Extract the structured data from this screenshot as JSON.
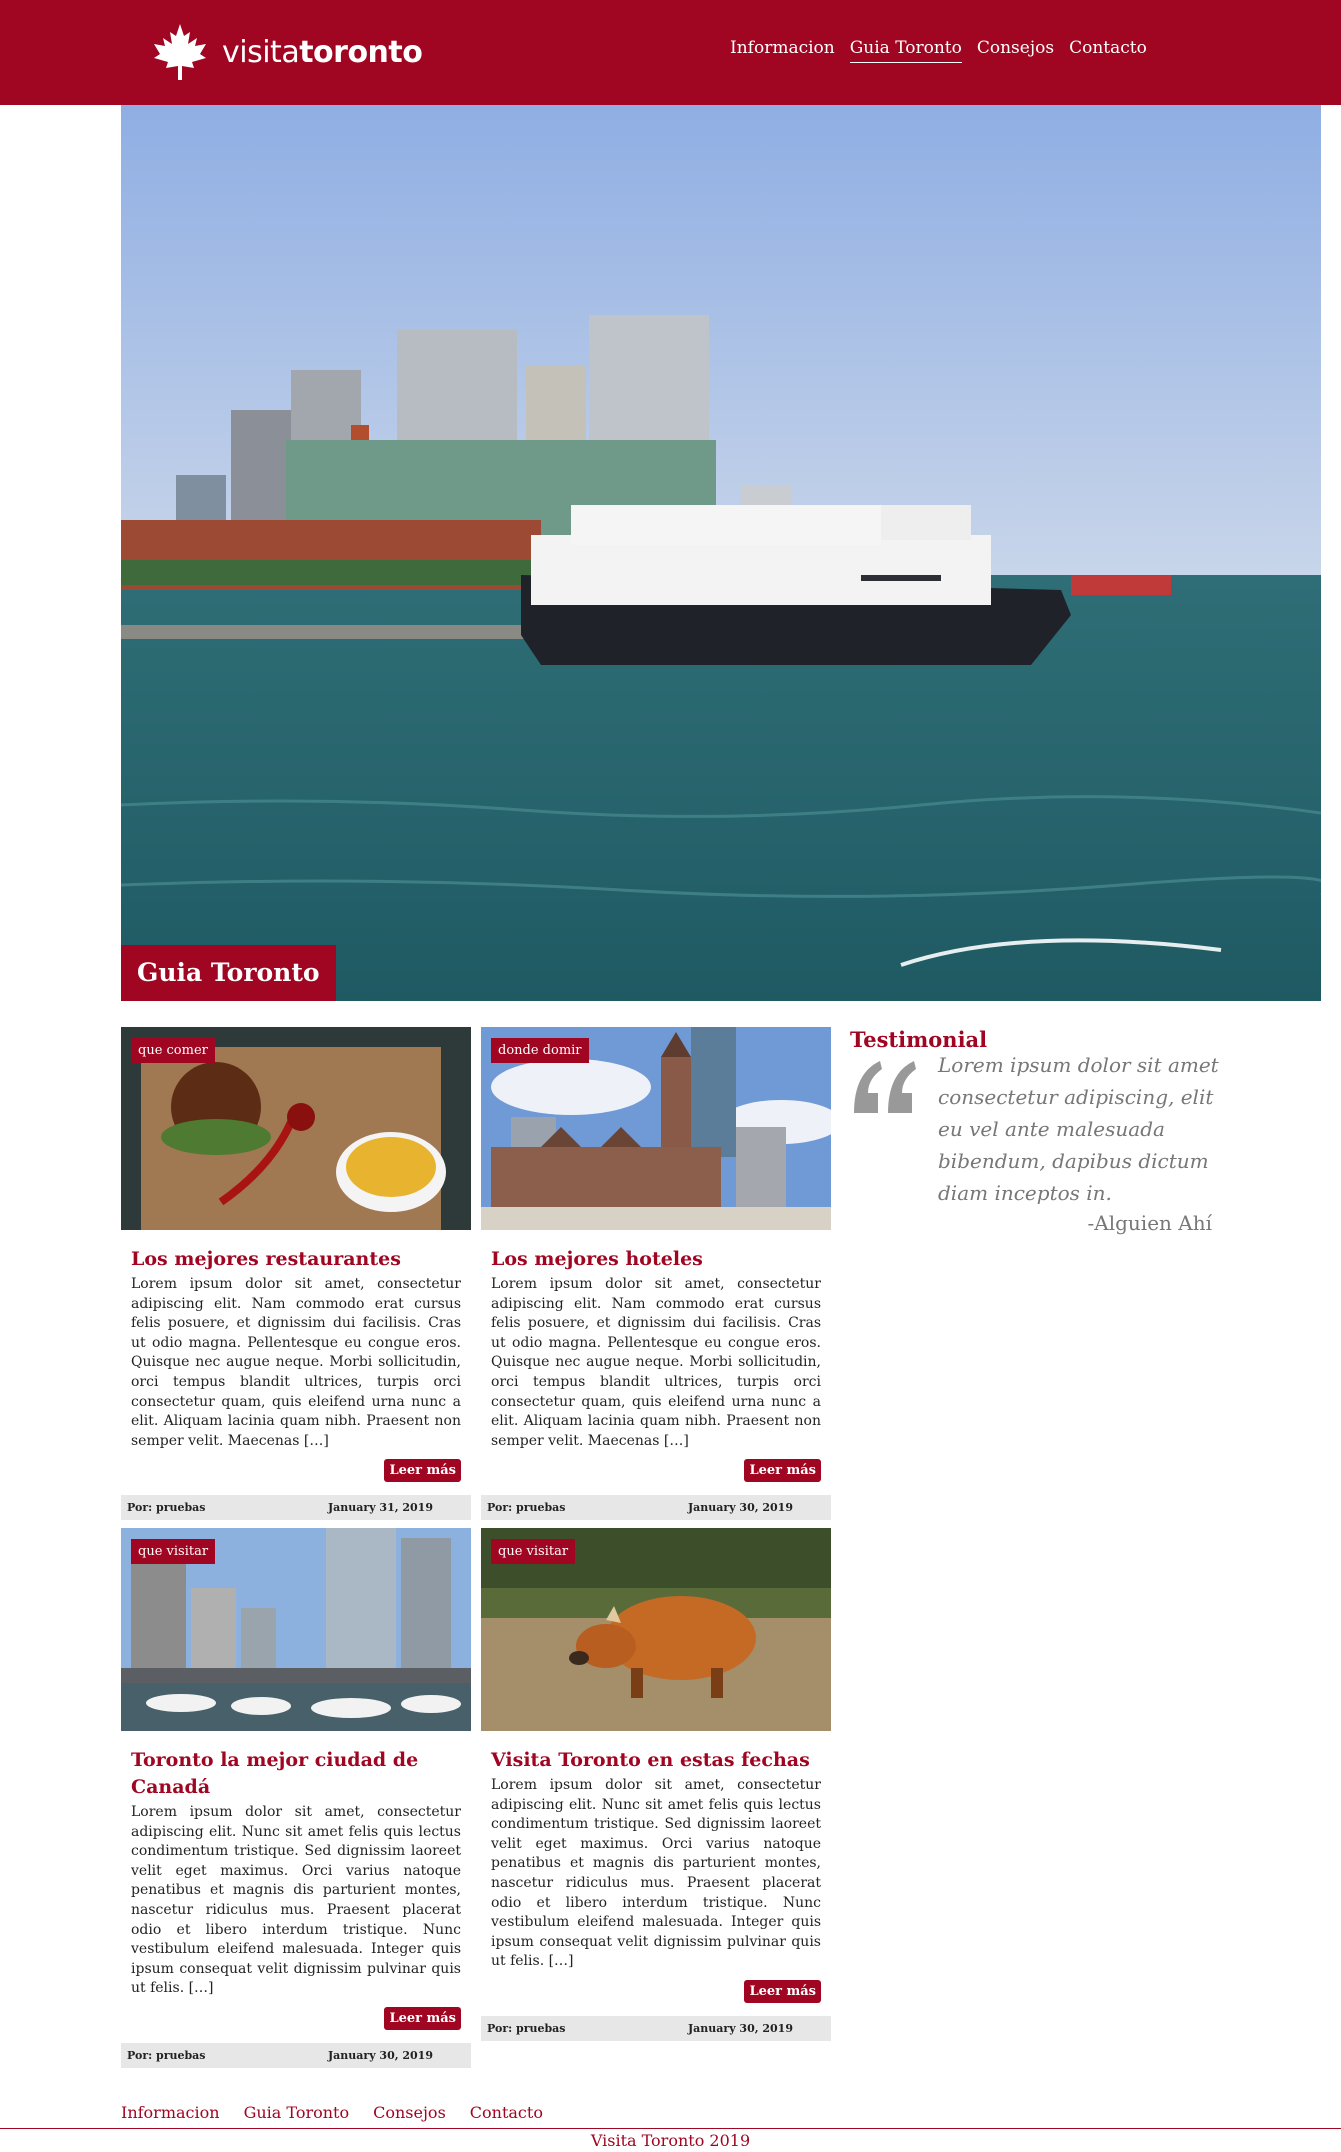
{
  "brand": {
    "light": "visita",
    "bold": "toronto"
  },
  "nav": [
    {
      "label": "Informacion"
    },
    {
      "label": "Guia Toronto",
      "active": true
    },
    {
      "label": "Consejos"
    },
    {
      "label": "Contacto"
    }
  ],
  "hero": {
    "caption": "Guia Toronto"
  },
  "cards": [
    {
      "tag": "que comer",
      "title": "Los mejores restaurantes",
      "text": "Lorem ipsum dolor sit amet, consectetur adipiscing elit. Nam commodo erat cursus felis posuere, et dignissim dui facilisis. Cras ut odio magna. Pellentesque eu congue eros. Quisque nec augue neque. Morbi sollicitudin, orci tempus blandit ultrices, turpis orci consectetur quam, quis eleifend urna nunc a elit. Aliquam lacinia quam nibh. Praesent non semper velit. Maecenas […]",
      "more": "Leer más",
      "author": "Por: pruebas",
      "date": "January 31, 2019"
    },
    {
      "tag": "donde domir",
      "title": "Los mejores hoteles",
      "text": "Lorem ipsum dolor sit amet, consectetur adipiscing elit. Nam commodo erat cursus felis posuere, et dignissim dui facilisis. Cras ut odio magna. Pellentesque eu congue eros. Quisque nec augue neque. Morbi sollicitudin, orci tempus blandit ultrices, turpis orci consectetur quam, quis eleifend urna nunc a elit. Aliquam lacinia quam nibh. Praesent non semper velit. Maecenas […]",
      "more": "Leer más",
      "author": "Por: pruebas",
      "date": "January 30, 2019"
    },
    {
      "tag": "que visitar",
      "title": "Toronto la mejor ciudad de Canadá",
      "text": "Lorem ipsum dolor sit amet, consectetur adipiscing elit. Nunc sit amet felis quis lectus condimentum tristique. Sed dignissim laoreet velit eget maximus. Orci varius natoque penatibus et magnis dis parturient montes, nascetur ridiculus mus. Praesent placerat odio et libero interdum tristique. Nunc vestibulum eleifend malesuada. Integer quis ipsum consequat velit dignissim pulvinar quis ut felis. […]",
      "more": "Leer más",
      "author": "Por: pruebas",
      "date": "January 30, 2019"
    },
    {
      "tag": "que visitar",
      "title": "Visita Toronto en estas fechas",
      "text": "Lorem ipsum dolor sit amet, consectetur adipiscing elit. Nunc sit amet felis quis lectus condimentum tristique. Sed dignissim laoreet velit eget maximus. Orci varius natoque penatibus et magnis dis parturient montes, nascetur ridiculus mus. Praesent placerat odio et libero interdum tristique. Nunc vestibulum eleifend malesuada. Integer quis ipsum consequat velit dignissim pulvinar quis ut felis. […]",
      "more": "Leer más",
      "author": "Por: pruebas",
      "date": "January 30, 2019"
    }
  ],
  "testimonial": {
    "heading": "Testimonial",
    "quote": "Lorem ipsum dolor sit amet consectetur adipiscing, elit eu vel ante malesuada bibendum, dapibus dictum diam inceptos in.",
    "author": "-Alguien Ahí"
  },
  "footer": {
    "links": [
      "Informacion",
      "Guia Toronto",
      "Consejos",
      "Contacto"
    ],
    "copyright": "Visita Toronto 2019"
  },
  "colors": {
    "brand": "#a00622",
    "meta_bg": "#e7e7e7",
    "quote": "#777777"
  },
  "icons": {
    "logo": "maple-leaf-icon",
    "quote": "quote-mark-icon"
  }
}
